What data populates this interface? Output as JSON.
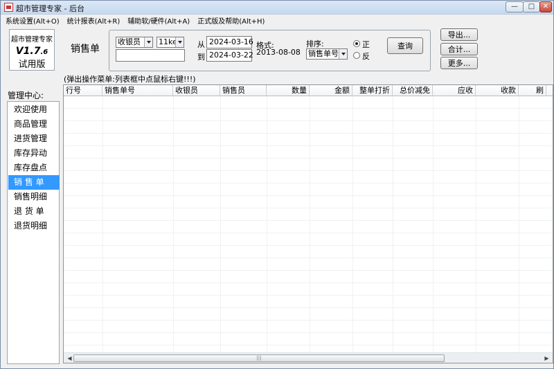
{
  "window": {
    "title": "超市管理专家 - 后台",
    "minimize_glyph": "—",
    "maximize_glyph": "□",
    "close_glyph": "✕"
  },
  "menu": [
    {
      "label": "系统设置(Alt+O)"
    },
    {
      "label": "统计报表(Alt+R)"
    },
    {
      "label": "辅助软/硬件(Alt+A)"
    },
    {
      "label": "正式版及帮助(Alt+H)"
    }
  ],
  "logo": {
    "line1": "超市管理专家",
    "version_main": "V1.7",
    "version_minor": ".6",
    "edition": "试用版"
  },
  "module_title": "销售单",
  "query": {
    "user_type_select": "收银员",
    "user_name_select": "11ke",
    "keyword_value": "",
    "from_label": "从",
    "to_label": "到",
    "date_from": "2024-03-16",
    "date_to": "2024-03-22",
    "format_label": "格式:",
    "format_example": "2013-08-08",
    "sort_label": "排序:",
    "sort_select": "销售单号",
    "order_asc_label": "正",
    "order_desc_label": "反",
    "order_selected": "asc",
    "query_button": "查询"
  },
  "actions": {
    "export": "导出...",
    "total": "合计...",
    "more": "更多..."
  },
  "hint": "(弹出操作菜单:列表框中点鼠标右键!!!)",
  "sidebar": {
    "title": "管理中心:",
    "items": [
      {
        "label": "欢迎使用",
        "selected": false
      },
      {
        "label": "商品管理",
        "selected": false
      },
      {
        "label": "进货管理",
        "selected": false
      },
      {
        "label": "库存异动",
        "selected": false
      },
      {
        "label": "库存盘点",
        "selected": false
      },
      {
        "label": "销 售 单",
        "selected": true
      },
      {
        "label": "销售明细",
        "selected": false
      },
      {
        "label": "退 货 单",
        "selected": false
      },
      {
        "label": "退货明细",
        "selected": false
      }
    ]
  },
  "grid": {
    "columns": [
      "行号",
      "销售单号",
      "收银员",
      "销售员",
      "数量",
      "金额",
      "整单打折",
      "总价减免",
      "应收",
      "收款",
      "刷"
    ],
    "rows": []
  },
  "colors": {
    "selection": "#3399ff",
    "window_bg": "#f0f0f0"
  }
}
